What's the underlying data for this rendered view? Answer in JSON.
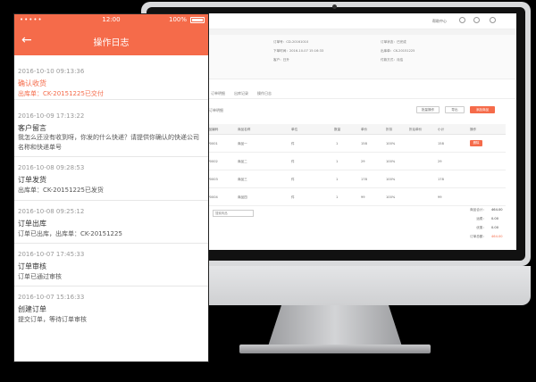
{
  "phone": {
    "status_bar": {
      "carrier": "•••••",
      "time": "12:00",
      "battery": "100%"
    },
    "nav": {
      "title": "操作日志",
      "back_icon": "arrow-left-icon"
    },
    "logs": [
      {
        "time": "2016-10-10 09:13:36",
        "title": "确认收货",
        "desc": "出库单：CK-20151225已交付",
        "active": true
      },
      {
        "time": "2016-10-09 17:13:22",
        "title": "客户留言",
        "desc": "我怎么还没有收到呀，你发的什么快递？请提供你确认的快递公司名称和快递单号",
        "active": false
      },
      {
        "time": "2016-10-08 09:28:53",
        "title": "订单发货",
        "desc": "出库单：CK-20151225已发货",
        "active": false
      },
      {
        "time": "2016-10-08 09:25:12",
        "title": "订单出库",
        "desc": "订单已出库，出库单：CK-20151225",
        "active": false
      },
      {
        "time": "2016-10-07 17:45:33",
        "title": "订单审核",
        "desc": "订单已通过审核",
        "active": false
      },
      {
        "time": "2016-10-07 15:16:33",
        "title": "创建订单",
        "desc": "提交订单，等待订单审核",
        "active": false
      }
    ]
  },
  "desktop": {
    "topbar": {
      "link": "帮助中心"
    },
    "info_lines": [
      "订单号：CD-20161010",
      "下单时间：2016-10-07 15:16:33",
      "订单状态：已完成",
      "出库单：CK-20151225",
      "客户：日升",
      "付款方式：月结"
    ],
    "tabs": [
      "订单明细",
      "出库记录",
      "操作日志"
    ],
    "toolbar": {
      "left": "订单明细",
      "btn_a": "批量操作",
      "btn_b": "导出",
      "btn_primary": "添加商品"
    },
    "table_headers": [
      "商品编码",
      "商品名称",
      "单位",
      "数量",
      "单价",
      "折扣",
      "折后单价",
      "小计",
      "操作"
    ],
    "rows": [
      {
        "code": "CP0001",
        "name": "商品一",
        "unit": "件",
        "qty": "1",
        "price": "158",
        "discount": "100%",
        "total": "158",
        "op": "删除"
      },
      {
        "code": "CP0002",
        "name": "商品二",
        "unit": "件",
        "qty": "1",
        "price": "29",
        "discount": "100%",
        "total": "29",
        "op": ""
      },
      {
        "code": "CP0003",
        "name": "商品三",
        "unit": "件",
        "qty": "1",
        "price": "178",
        "discount": "100%",
        "total": "178",
        "op": ""
      },
      {
        "code": "CP0004",
        "name": "商品四",
        "unit": "件",
        "qty": "1",
        "price": "99",
        "discount": "100%",
        "total": "99",
        "op": ""
      }
    ],
    "search_placeholder": "搜索商品",
    "summary": [
      {
        "label": "商品合计：",
        "value": "464.00"
      },
      {
        "label": "运费：",
        "value": "0.00"
      },
      {
        "label": "优惠：",
        "value": "0.00"
      },
      {
        "label": "订单总额：",
        "value": "464.00"
      }
    ]
  }
}
